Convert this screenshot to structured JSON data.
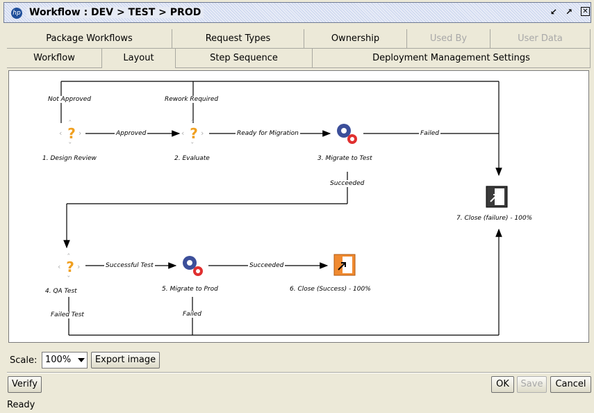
{
  "window": {
    "title": "Workflow : DEV > TEST > PROD"
  },
  "tabs": {
    "row1": [
      {
        "label": "Package Workflows"
      },
      {
        "label": "Request Types"
      },
      {
        "label": "Ownership"
      },
      {
        "label": "Used By"
      },
      {
        "label": "User Data"
      }
    ],
    "row2": [
      {
        "label": "Workflow"
      },
      {
        "label": "Layout"
      },
      {
        "label": "Step Sequence"
      },
      {
        "label": "Deployment Management Settings"
      }
    ],
    "active": "Layout"
  },
  "diagram": {
    "nodes": [
      {
        "id": "n1",
        "label": "1. Design Review",
        "icon": "question-decision-icon"
      },
      {
        "id": "n2",
        "label": "2. Evaluate",
        "icon": "question-decision-icon"
      },
      {
        "id": "n3",
        "label": "3. Migrate to Test",
        "icon": "gears-execution-icon"
      },
      {
        "id": "n4",
        "label": "4. QA Test",
        "icon": "question-decision-icon"
      },
      {
        "id": "n5",
        "label": "5. Migrate to Prod",
        "icon": "gears-execution-icon"
      },
      {
        "id": "n6",
        "label": "6. Close (Success) - 100%",
        "icon": "close-success-icon"
      },
      {
        "id": "n7",
        "label": "7. Close (failure) - 100%",
        "icon": "close-failure-icon"
      }
    ],
    "edges": [
      {
        "label": "Not Approved"
      },
      {
        "label": "Approved"
      },
      {
        "label": "Rework Required"
      },
      {
        "label": "Ready for Migration"
      },
      {
        "label": "Failed"
      },
      {
        "label": "Succeeded"
      },
      {
        "label": "Successful Test"
      },
      {
        "label": "Succeeded"
      },
      {
        "label": "Failed Test"
      },
      {
        "label": "Failed"
      }
    ]
  },
  "toolbar": {
    "scale_label": "Scale:",
    "scale_value": "100%",
    "export_label": "Export image"
  },
  "footer": {
    "verify_label": "Verify",
    "ok_label": "OK",
    "save_label": "Save",
    "cancel_label": "Cancel"
  },
  "status": {
    "text": "Ready"
  }
}
